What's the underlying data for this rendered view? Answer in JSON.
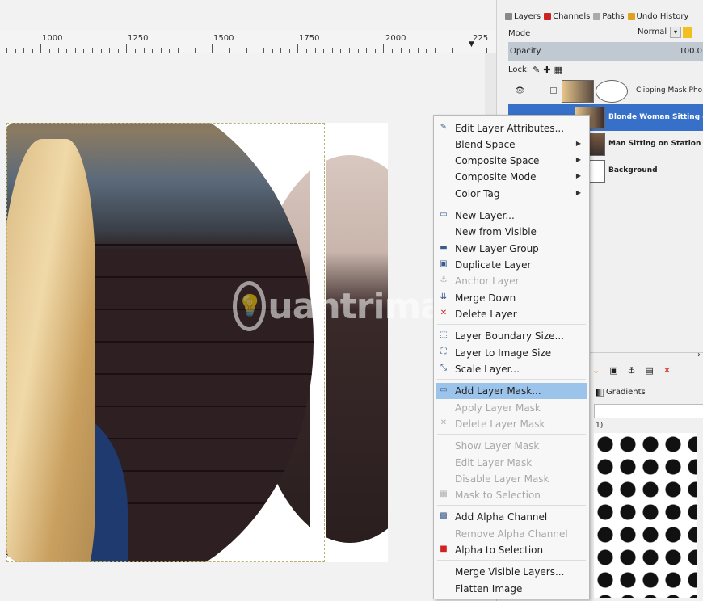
{
  "ruler": {
    "ticks": [
      "1000",
      "1250",
      "1500",
      "1750",
      "2000",
      "225"
    ]
  },
  "canvas": {
    "watermark": "uantrimang"
  },
  "dock": {
    "tabs": [
      {
        "label": "Layers",
        "icon": "layers-icon",
        "color": "#888888"
      },
      {
        "label": "Channels",
        "icon": "channels-icon",
        "color": "#cc2222"
      },
      {
        "label": "Paths",
        "icon": "paths-icon",
        "color": "#666666"
      },
      {
        "label": "Undo History",
        "icon": "undo-icon",
        "color": "#e0a020"
      }
    ],
    "mode_label": "Mode",
    "mode_value": "Normal",
    "opacity_label": "Opacity",
    "opacity_value": "100.0",
    "lock_label": "Lock:",
    "layers": [
      {
        "name": "Clipping Mask Pho",
        "selected": false
      },
      {
        "name": "Blonde Woman Sitting o",
        "selected": true
      },
      {
        "name": "Man Sitting on Station B",
        "selected": false
      },
      {
        "name": "Background",
        "selected": false
      }
    ],
    "gradients_label": "Gradients",
    "brush_label": "1)"
  },
  "menu": {
    "items": [
      {
        "label": "Edit Layer Attributes...",
        "icon": "edit-icon",
        "state": "normal"
      },
      {
        "label": "Blend Space",
        "submenu": true,
        "state": "normal"
      },
      {
        "label": "Composite Space",
        "submenu": true,
        "state": "normal"
      },
      {
        "label": "Composite Mode",
        "submenu": true,
        "state": "normal"
      },
      {
        "label": "Color Tag",
        "submenu": true,
        "state": "normal"
      },
      {
        "label": "New Layer...",
        "icon": "new-layer-icon",
        "state": "normal"
      },
      {
        "label": "New from Visible",
        "state": "normal"
      },
      {
        "label": "New Layer Group",
        "icon": "folder-icon",
        "state": "normal"
      },
      {
        "label": "Duplicate Layer",
        "icon": "duplicate-icon",
        "state": "normal"
      },
      {
        "label": "Anchor Layer",
        "icon": "anchor-icon",
        "state": "disabled"
      },
      {
        "label": "Merge Down",
        "icon": "merge-icon",
        "state": "normal"
      },
      {
        "label": "Delete Layer",
        "icon": "delete-icon",
        "state": "normal"
      },
      {
        "label": "Layer Boundary Size...",
        "icon": "boundary-icon",
        "state": "normal"
      },
      {
        "label": "Layer to Image Size",
        "icon": "fit-icon",
        "state": "normal"
      },
      {
        "label": "Scale Layer...",
        "icon": "scale-icon",
        "state": "normal"
      },
      {
        "label": "Add Layer Mask...",
        "icon": "mask-icon",
        "state": "highlight"
      },
      {
        "label": "Apply Layer Mask",
        "state": "disabled"
      },
      {
        "label": "Delete Layer Mask",
        "icon": "delete-icon",
        "state": "disabled"
      },
      {
        "label": "Show Layer Mask",
        "state": "disabled"
      },
      {
        "label": "Edit Layer Mask",
        "state": "disabled"
      },
      {
        "label": "Disable Layer Mask",
        "state": "disabled"
      },
      {
        "label": "Mask to Selection",
        "icon": "mask-selection-icon",
        "state": "disabled"
      },
      {
        "label": "Add Alpha Channel",
        "icon": "alpha-icon",
        "state": "normal"
      },
      {
        "label": "Remove Alpha Channel",
        "state": "disabled"
      },
      {
        "label": "Alpha to Selection",
        "icon": "alpha-selection-icon",
        "state": "normal"
      },
      {
        "label": "Merge Visible Layers...",
        "state": "normal"
      },
      {
        "label": "Flatten Image",
        "state": "normal"
      }
    ]
  }
}
